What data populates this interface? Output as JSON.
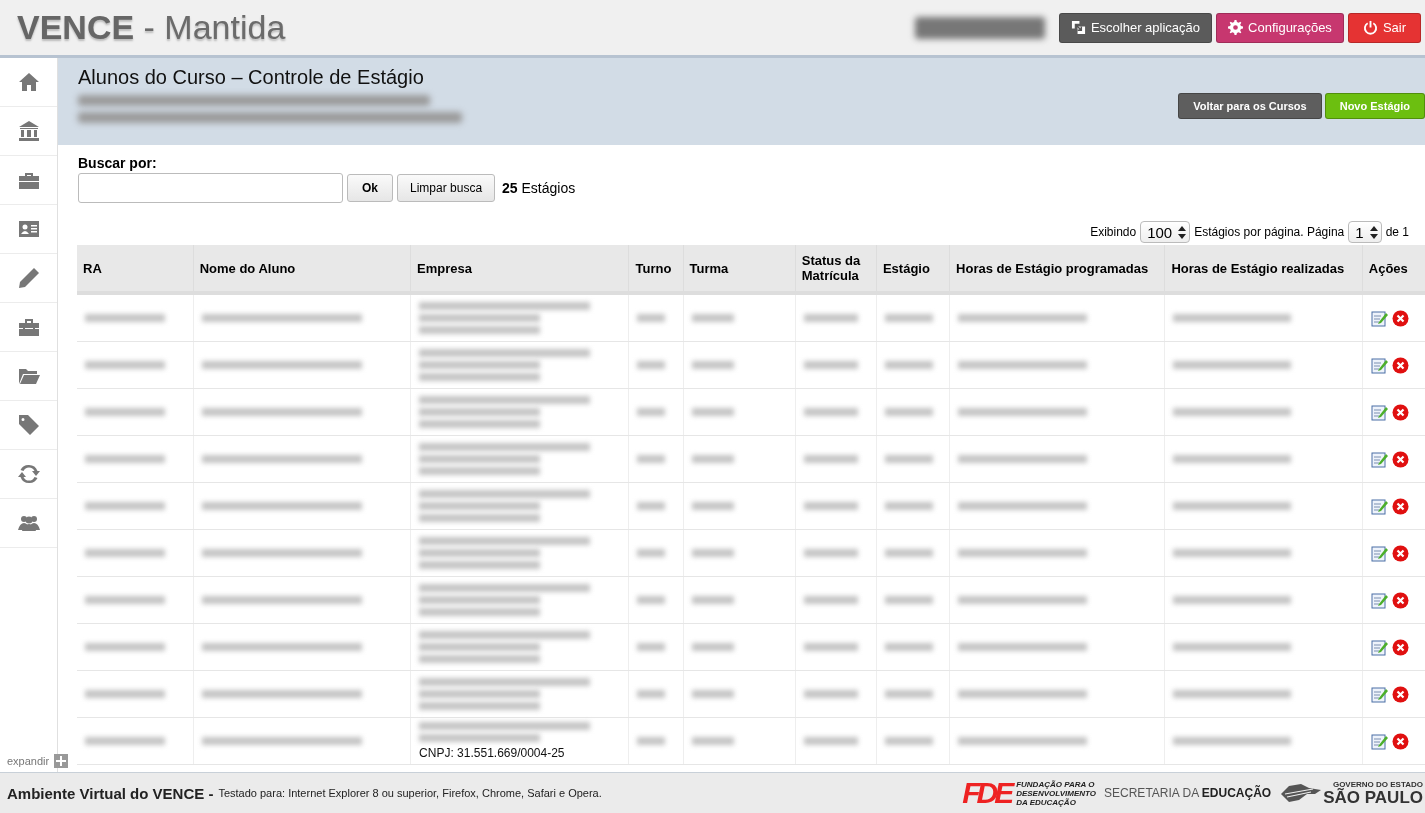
{
  "header": {
    "title": "**VENCE** - Mantida",
    "buttons": [
      {
        "kind": "switch",
        "label": "Escolher aplicação"
      },
      {
        "kind": "settings",
        "label": "Configurações"
      },
      {
        "kind": "exit",
        "label": "Sair"
      }
    ]
  },
  "sidebar": {
    "items": [
      {
        "kind": "home"
      },
      {
        "kind": "bank"
      },
      {
        "kind": "briefcase"
      },
      {
        "kind": "card"
      },
      {
        "kind": "pencil"
      },
      {
        "kind": "toolbox"
      },
      {
        "kind": "folder"
      },
      {
        "kind": "tag"
      },
      {
        "kind": "refresh"
      },
      {
        "kind": "users"
      }
    ],
    "expand_label": "expandir"
  },
  "page": {
    "title": "Alunos do Curso – Controle de Estágio",
    "buttons": [
      {
        "kind": "back",
        "label": "Voltar para os Cursos"
      },
      {
        "kind": "new",
        "label": "Novo Estágio"
      }
    ]
  },
  "search": {
    "label": "Buscar por:",
    "ok": "Ok",
    "clear": "Limpar busca",
    "count": "25",
    "count_label": "Estágios"
  },
  "pagination": {
    "showing": "Exibindo",
    "per_page": "100",
    "per_page_label": "Estágios por página. Página",
    "page": "1",
    "of": "de 1"
  },
  "table": {
    "columns": [
      "RA",
      "Nome do Aluno",
      "Empresa",
      "Turno",
      "Turma",
      "Status da Matrícula",
      "Estágio",
      "Horas de Estágio programadas",
      "Horas de Estágio realizadas",
      "Ações"
    ],
    "rows": [
      {
        "kind": "redacted"
      },
      {
        "kind": "redacted"
      },
      {
        "kind": "redacted"
      },
      {
        "kind": "redacted"
      },
      {
        "kind": "redacted"
      },
      {
        "kind": "redacted"
      },
      {
        "kind": "redacted"
      },
      {
        "kind": "redacted"
      },
      {
        "kind": "redacted"
      },
      {
        "kind": "redacted",
        "empresa_tail": "CNPJ: 31.551.669/0004-25"
      }
    ]
  },
  "footer": {
    "title": "Ambiente Virtual do VENCE -",
    "note": "Testado para: Internet Explorer 8 ou superior, Firefox, Chrome, Safari e Opera.",
    "fde": "FDE",
    "fde_text": "FUNDAÇÃO PARA O\nDESENVOLVIMENTO\nDA EDUCAÇÃO",
    "secretaria": "SECRETARIA DA **EDUCAÇÃO**",
    "gov_top": "GOVERNO DO ESTADO",
    "gov_bottom": "SÃO PAULO"
  }
}
